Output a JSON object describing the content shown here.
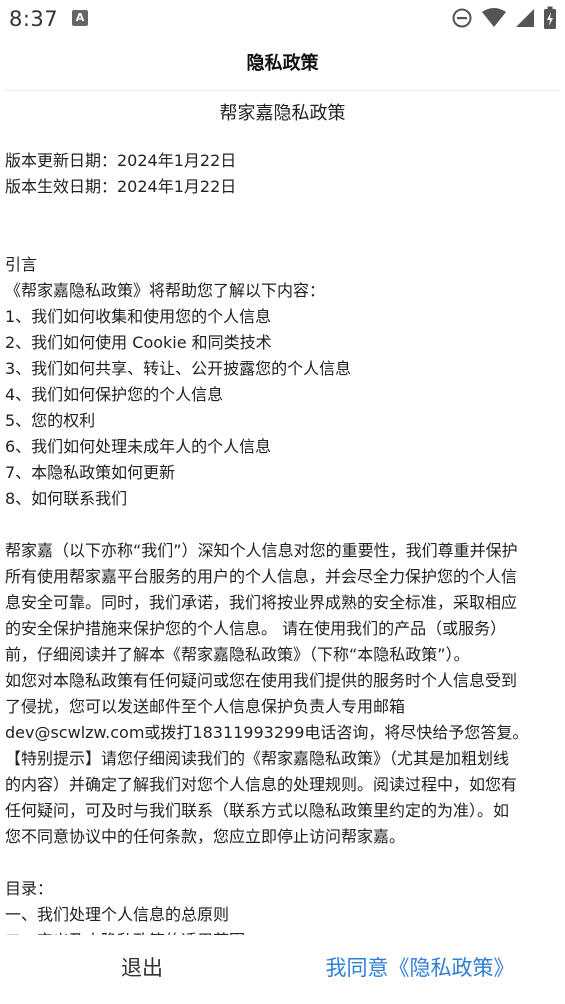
{
  "status_bar": {
    "time": "8:37",
    "notification_glyph": "A",
    "icons": [
      "do-not-disturb-icon",
      "wifi-icon",
      "cellular-signal-icon",
      "battery-icon"
    ]
  },
  "header": {
    "title": "隐私政策"
  },
  "document": {
    "title": "帮家嘉隐私政策",
    "update_date": "版本更新日期：2024年1月22日",
    "effective_date": "版本生效日期：2024年1月22日",
    "intro_heading": "引言",
    "intro_text": "《帮家嘉隐私政策》将帮助您了解以下内容：",
    "toc_items": [
      "1、我们如何收集和使用您的个人信息",
      "2、我们如何使用 Cookie 和同类技术",
      "3、我们如何共享、转让、公开披露您的个人信息",
      "4、我们如何保护您的个人信息",
      "5、您的权利",
      "6、我们如何处理未成年人的个人信息",
      "7、本隐私政策如何更新",
      "8、如何联系我们"
    ],
    "body_lines": [
      "帮家嘉（以下亦称“我们”）深知个人信息对您的重要性，我们尊重并保护",
      "所有使用帮家嘉平台服务的用户的个人信息，并会尽全力保护您的个人信",
      "息安全可靠。同时，我们承诺，我们将按业界成熟的安全标准，采取相应",
      "的安全保护措施来保护您的个人信息。 请在使用我们的产品（或服务）",
      "前，仔细阅读并了解本《帮家嘉隐私政策》（下称“本隐私政策”）。",
      "如您对本隐私政策有任何疑问或您在使用我们提供的服务时个人信息受到",
      "了侵扰，您可以发送邮件至个人信息保护负责人专用邮箱",
      "dev@scwlzw.com或拨打18311993299电话咨询，将尽快给予您答复。",
      "【特别提示】请您仔细阅读我们的《帮家嘉隐私政策》（尤其是加粗划线",
      "的内容）并确定了解我们对您个人信息的处理规则。阅读过程中，如您有",
      "任何疑问，可及时与我们联系（联系方式以隐私政策里约定的为准）。如",
      "您不同意协议中的任何条款，您应立即停止访问帮家嘉。"
    ],
    "catalog_heading": "目录：",
    "catalog_items": [
      "一、我们处理个人信息的总原则",
      "二、定义及本隐私政策的适用范围"
    ]
  },
  "footer": {
    "exit_label": "退出",
    "agree_label": "我同意《隐私政策》"
  },
  "colors": {
    "accent": "#2f7fd6",
    "text": "#222222",
    "divider": "#eeeeee"
  }
}
